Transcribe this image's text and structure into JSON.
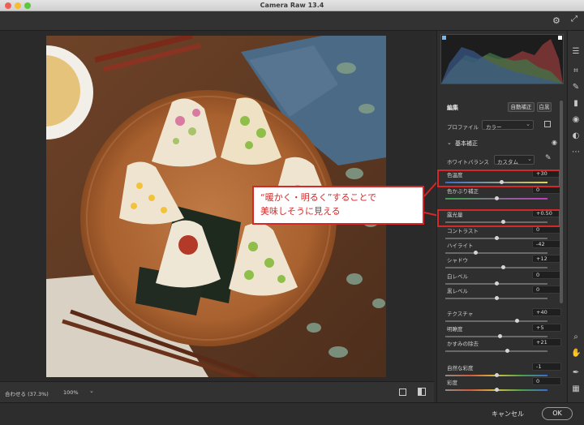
{
  "window": {
    "title": "Camera Raw 13.4",
    "traffic_colors": [
      "#ee5f57",
      "#f5bd2f",
      "#5ac73c"
    ]
  },
  "edit_panel": {
    "heading": "編集",
    "auto_label": "自動補正",
    "bw_label": "白黒",
    "profile_label": "プロファイル",
    "profile_value": "カラー",
    "section_basic": "基本補正",
    "wb_label": "ホワイトバランス",
    "wb_value": "カスタム",
    "sliders": [
      {
        "label": "色温度",
        "value": "+30",
        "level": 0.55
      },
      {
        "label": "色かぶり補正",
        "value": "0",
        "level": 0.5
      },
      {
        "label": "露光量",
        "value": "+0.50",
        "level": 0.56
      },
      {
        "label": "コントラスト",
        "value": "0",
        "level": 0.5
      },
      {
        "label": "ハイライト",
        "value": "-42",
        "level": 0.29
      },
      {
        "label": "シャドウ",
        "value": "+12",
        "level": 0.56
      },
      {
        "label": "白レベル",
        "value": "0",
        "level": 0.5
      },
      {
        "label": "黒レベル",
        "value": "0",
        "level": 0.5
      },
      {
        "label": "テクスチャ",
        "value": "+40",
        "level": 0.7
      },
      {
        "label": "明瞭度",
        "value": "+5",
        "level": 0.53
      },
      {
        "label": "かすみの除去",
        "value": "+21",
        "level": 0.6
      },
      {
        "label": "自然な彩度",
        "value": "-1",
        "level": 0.5
      },
      {
        "label": "彩度",
        "value": "0",
        "level": 0.5
      }
    ]
  },
  "bottom": {
    "zoom_fit": "合わせる (37.3%)",
    "zoom_100": "100%"
  },
  "footer": {
    "cancel": "キャンセル",
    "ok": "OK"
  },
  "annotation": {
    "line1": "“暖かく・明るく”することで",
    "line2": "美味しそうに見える"
  },
  "colors": {
    "highlight": "#d62828"
  }
}
